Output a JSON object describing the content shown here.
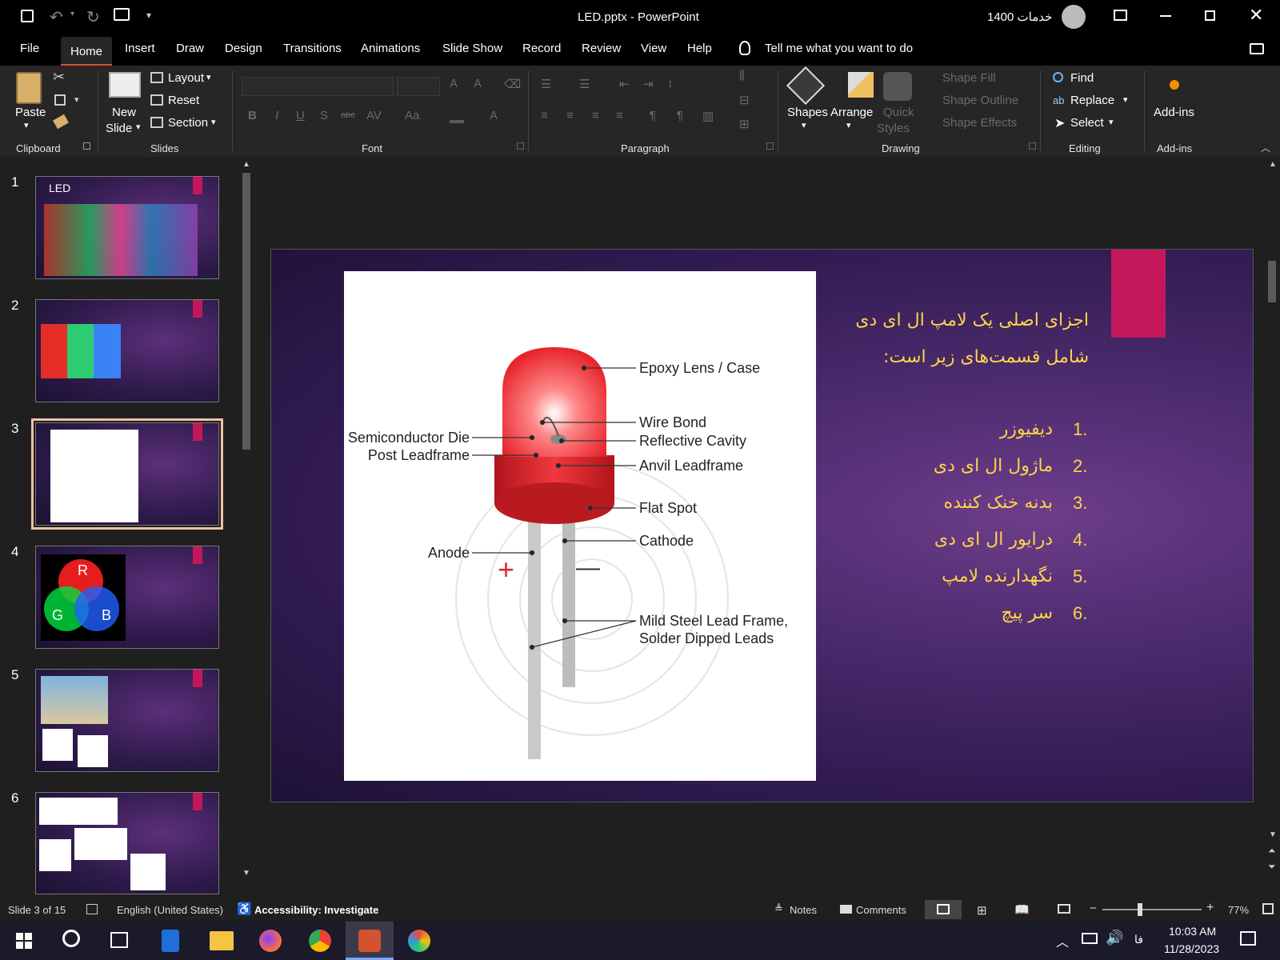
{
  "window": {
    "title": "LED.pptx  -  PowerPoint",
    "user_name": "خدمات 1400"
  },
  "qat": {
    "icons": [
      "save-icon",
      "undo-icon",
      "redo-icon",
      "present-icon",
      "customize-icon"
    ]
  },
  "tabs": [
    "File",
    "Home",
    "Insert",
    "Draw",
    "Design",
    "Transitions",
    "Animations",
    "Slide Show",
    "Record",
    "Review",
    "View",
    "Help"
  ],
  "active_tab": "Home",
  "tell_me": "Tell me what you want to do",
  "ribbon": {
    "clipboard": {
      "paste": "Paste",
      "label": "Clipboard"
    },
    "slides": {
      "new_slide_1": "New",
      "new_slide_2": "Slide",
      "layout": "Layout",
      "reset": "Reset",
      "section": "Section",
      "label": "Slides"
    },
    "font": {
      "label": "Font"
    },
    "paragraph": {
      "label": "Paragraph"
    },
    "drawing": {
      "shapes": "Shapes",
      "arrange": "Arrange",
      "quick_1": "Quick",
      "quick_2": "Styles",
      "shape_fill": "Shape Fill",
      "shape_outline": "Shape Outline",
      "shape_effects": "Shape Effects",
      "label": "Drawing"
    },
    "editing": {
      "find": "Find",
      "replace": "Replace",
      "select": "Select",
      "label": "Editing"
    },
    "addins": {
      "button": "Add-ins",
      "label": "Add-ins"
    }
  },
  "thumbnails": [
    {
      "num": "1",
      "title": "LED"
    },
    {
      "num": "2"
    },
    {
      "num": "3"
    },
    {
      "num": "4",
      "r": "R",
      "g": "G",
      "b": "B"
    },
    {
      "num": "5"
    },
    {
      "num": "6"
    }
  ],
  "selected_slide": 3,
  "slide": {
    "heading_line1": "اجزای اصلی یک لامپ ال ای دی",
    "heading_line2": "شامل قسمت‌های زیر است:",
    "list": [
      {
        "num": "1.",
        "text": "دیفیوزر"
      },
      {
        "num": "2.",
        "text": "ماژول ال ای دی"
      },
      {
        "num": "3.",
        "text": "بدنه خنک کننده"
      },
      {
        "num": "4.",
        "text": "درایور ال ای دی"
      },
      {
        "num": "5.",
        "text": "نگهدارنده لامپ"
      },
      {
        "num": "6.",
        "text": "سر پیچ"
      }
    ],
    "diagram_labels": {
      "epoxy": "Epoxy Lens / Case",
      "wire_bond": "Wire Bond",
      "reflective": "Reflective Cavity",
      "semiconductor": "Semiconductor Die",
      "post": "Post Leadframe",
      "anvil": "Anvil Leadframe",
      "flat_spot": "Flat Spot",
      "cathode": "Cathode",
      "anode": "Anode",
      "mild_1": "Mild Steel Lead Frame,",
      "mild_2": "Solder Dipped Leads",
      "plus": "+",
      "minus": "—"
    }
  },
  "status": {
    "slide_of": "Slide 3 of 15",
    "language": "English (United States)",
    "accessibility": "Accessibility: Investigate",
    "notes": "Notes",
    "comments": "Comments",
    "zoom": "77%"
  },
  "taskbar": {
    "lang": "فا",
    "time": "10:03 AM",
    "date": "11/28/2023"
  },
  "colors": {
    "accent": "#d35230",
    "slide_text": "#ffd44a",
    "pink_block": "#c2185b",
    "led_red": "#e8242b"
  }
}
